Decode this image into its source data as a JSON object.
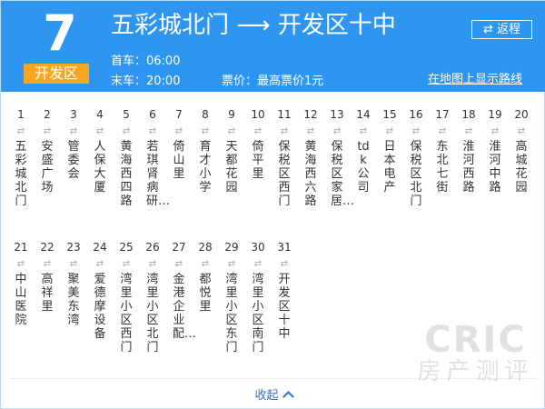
{
  "header": {
    "route_number": "7",
    "route_tag": "开发区",
    "route_title": "五彩城北门 ⟶ 开发区十中",
    "first_bus": "首车：06:00",
    "last_bus": "末车：20:00",
    "fare": "票价：最高票价1元",
    "return_label": "⇄ 返程",
    "map_link": "在地图上显示路线"
  },
  "stops": [
    {
      "num": "1",
      "name": "五彩城北门"
    },
    {
      "num": "2",
      "name": "安盛广场"
    },
    {
      "num": "3",
      "name": "管委会"
    },
    {
      "num": "4",
      "name": "人保大厦"
    },
    {
      "num": "5",
      "name": "黄海西四路"
    },
    {
      "num": "6",
      "name": "若琪肾病研…"
    },
    {
      "num": "7",
      "name": "倚山里"
    },
    {
      "num": "8",
      "name": "育才小学"
    },
    {
      "num": "9",
      "name": "天都花园"
    },
    {
      "num": "10",
      "name": "倚平里"
    },
    {
      "num": "11",
      "name": "保税区西门"
    },
    {
      "num": "12",
      "name": "黄海西六路"
    },
    {
      "num": "13",
      "name": "保税区家居…"
    },
    {
      "num": "14",
      "name": "tdk公司"
    },
    {
      "num": "15",
      "name": "日本电产"
    },
    {
      "num": "16",
      "name": "保税区北门"
    },
    {
      "num": "17",
      "name": "东北七街"
    },
    {
      "num": "18",
      "name": "淮河西路"
    },
    {
      "num": "19",
      "name": "淮河中路"
    },
    {
      "num": "20",
      "name": "高城花园"
    },
    {
      "num": "21",
      "name": "中山医院"
    },
    {
      "num": "22",
      "name": "高祥里"
    },
    {
      "num": "23",
      "name": "聚美东湾"
    },
    {
      "num": "24",
      "name": "爱德摩设备"
    },
    {
      "num": "25",
      "name": "湾里小区西门"
    },
    {
      "num": "26",
      "name": "湾里小区北门"
    },
    {
      "num": "27",
      "name": "金港企业配…"
    },
    {
      "num": "28",
      "name": "都悦里"
    },
    {
      "num": "29",
      "name": "湾里小区东门"
    },
    {
      "num": "30",
      "name": "湾里小区南门"
    },
    {
      "num": "31",
      "name": "开发区十中"
    }
  ],
  "stop_arrow": "⇄",
  "collapse_label": "收起",
  "watermark": {
    "line1": "CRIC",
    "line2": "房产测评"
  },
  "colors": {
    "header_bg": "#2e96f0",
    "tag_bg": "#f6a623",
    "link": "#2e6fc7"
  }
}
